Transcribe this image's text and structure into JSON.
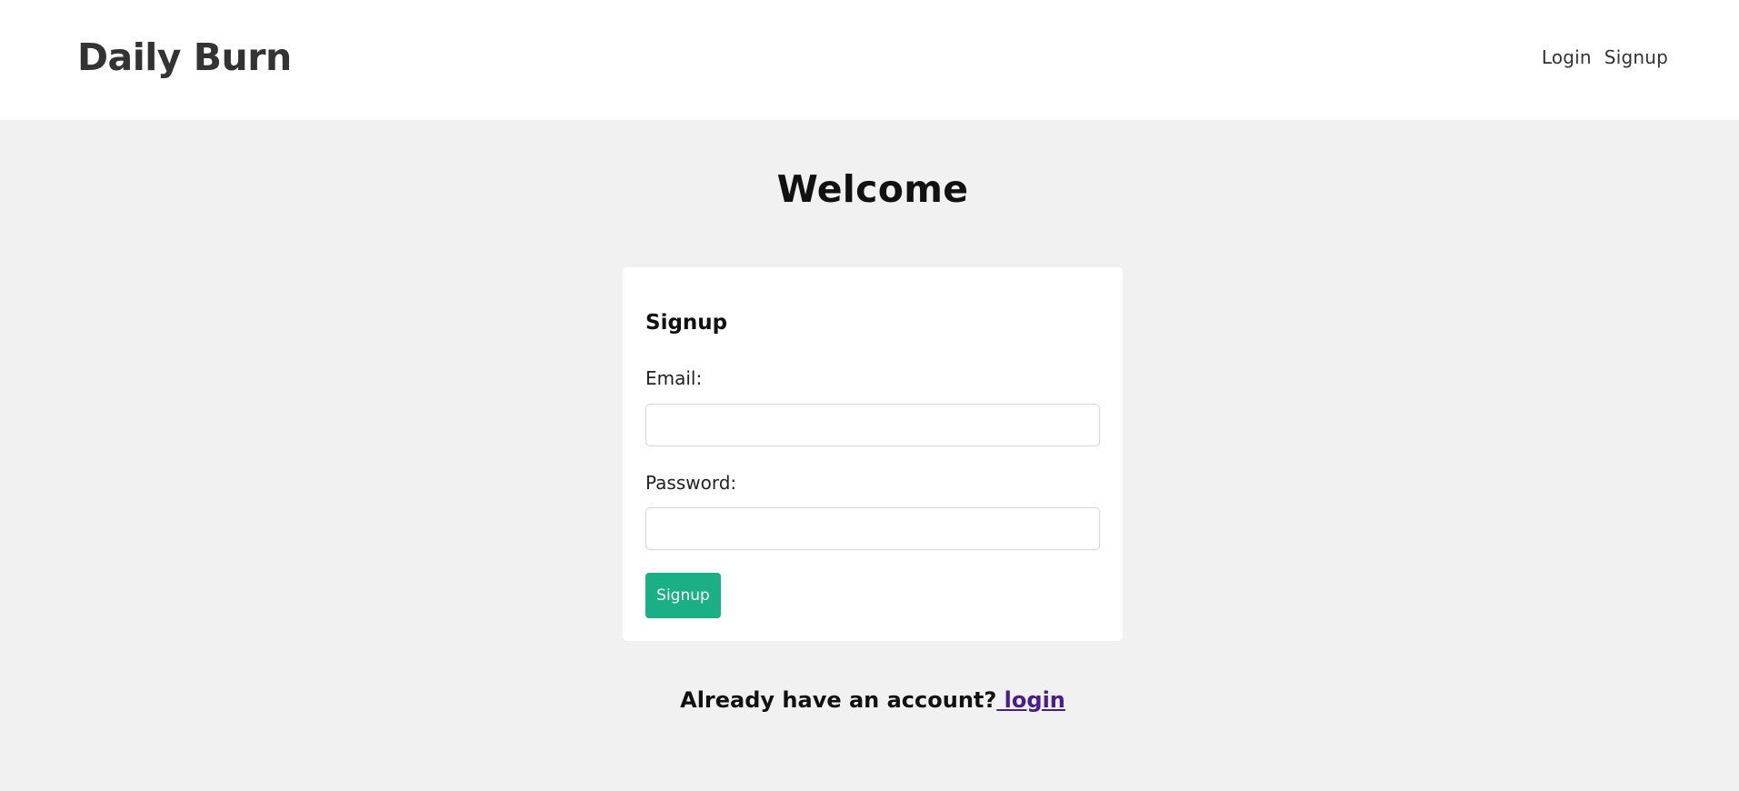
{
  "header": {
    "brand": "Daily Burn",
    "nav": {
      "login_label": "Login",
      "signup_label": "Signup"
    }
  },
  "main": {
    "title": "Welcome"
  },
  "form": {
    "heading": "Signup",
    "email_label": "Email:",
    "email_value": "",
    "password_label": "Password:",
    "password_value": "",
    "submit_label": "Signup"
  },
  "footer": {
    "prompt_text": "Already have an account?",
    "login_link_label": " login"
  },
  "colors": {
    "page_background": "#f1f1f1",
    "button_accent": "#1aaf84",
    "link_visited": "#4a1d8c"
  }
}
